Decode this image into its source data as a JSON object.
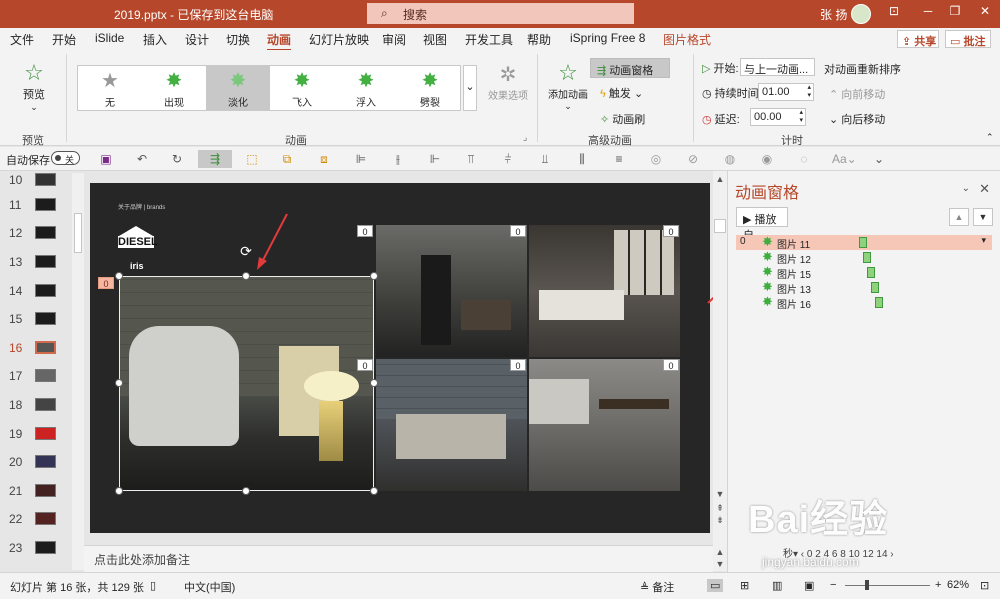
{
  "window": {
    "doc_title": "2019.pptx  -  已保存到这台电脑",
    "search_placeholder": "搜索",
    "user_name": "张 扬",
    "min": "─",
    "restore": "❐",
    "close": "✕"
  },
  "tabs": [
    "文件",
    "开始",
    "iSlide",
    "插入",
    "设计",
    "切换",
    "动画",
    "幻灯片放映",
    "审阅",
    "视图",
    "开发工具",
    "帮助",
    "iSpring Free 8",
    "图片格式"
  ],
  "share_label": "共享",
  "comment_label": "批注",
  "ribbon": {
    "preview_label": "预览",
    "preview_group": "预览",
    "gallery": [
      "无",
      "出现",
      "淡化",
      "飞入",
      "浮入",
      "劈裂"
    ],
    "effect_options": "效果选项",
    "anim_group": "动画",
    "add_anim": "添加动画",
    "anim_pane": "动画窗格",
    "trigger": "触发",
    "anim_painter": "动画刷",
    "adv_group": "高级动画",
    "start_label": "开始:",
    "start_value": "与上一动画...",
    "duration_label": "持续时间:",
    "duration_value": "01.00",
    "delay_label": "延迟:",
    "delay_value": "00.00",
    "reorder_title": "对动画重新排序",
    "move_earlier": "向前移动",
    "move_later": "向后移动",
    "timing_group": "计时"
  },
  "qat": {
    "autosave": "自动保存",
    "toggle": "关"
  },
  "thumbnails": [
    {
      "num": "10"
    },
    {
      "num": "11"
    },
    {
      "num": "12"
    },
    {
      "num": "13"
    },
    {
      "num": "14"
    },
    {
      "num": "15"
    },
    {
      "num": "16"
    },
    {
      "num": "17"
    },
    {
      "num": "18"
    },
    {
      "num": "19"
    },
    {
      "num": "20"
    },
    {
      "num": "21"
    },
    {
      "num": "22"
    },
    {
      "num": "23"
    }
  ],
  "slide": {
    "about": "关于品牌 | brands",
    "diesel": "DIESEL",
    "iris": "iris",
    "badges": [
      "0",
      "0",
      "0",
      "0",
      "0",
      "0"
    ],
    "selected_badge": "0"
  },
  "notes_placeholder": "点击此处添加备注",
  "anim_pane": {
    "title": "动画窗格",
    "play_from": "播放自",
    "items": [
      {
        "num": "0",
        "name": "图片 11",
        "menu": "▾"
      },
      {
        "num": "",
        "name": "图片 12"
      },
      {
        "num": "",
        "name": "图片 15"
      },
      {
        "num": "",
        "name": "图片 13"
      },
      {
        "num": "",
        "name": "图片 16"
      }
    ],
    "timeline": "秒▾   ‹ 0  2  4  6  8  10  12  14  ›"
  },
  "status": {
    "slide_info": "幻灯片 第 16 张，共 129 张",
    "language": "中文(中国)",
    "notes_btn": "备注",
    "zoom": "62%"
  },
  "watermark": {
    "brand": "Bai经验",
    "url": "jingyan.baidu.com"
  }
}
